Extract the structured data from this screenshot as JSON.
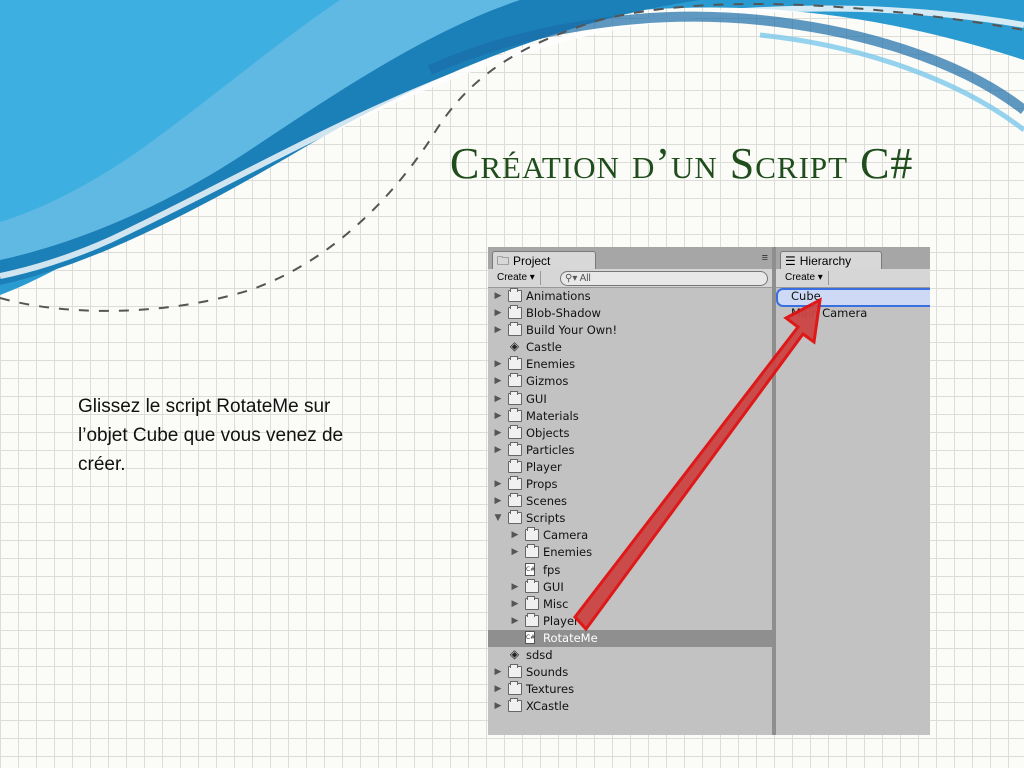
{
  "slide": {
    "title": "Création d’un Script C#",
    "body_text": "Glissez le script RotateMe sur l’objet Cube que vous venez de créer."
  },
  "project_panel": {
    "tab_label": "Project",
    "create_label": "Create ▾",
    "search_placeholder": "All",
    "menu_icon": "≡",
    "items": [
      {
        "label": "Animations",
        "type": "folder",
        "depth": 0,
        "expandable": true
      },
      {
        "label": "Blob-Shadow",
        "type": "folder",
        "depth": 0,
        "expandable": true
      },
      {
        "label": "Build Your Own!",
        "type": "folder",
        "depth": 0,
        "expandable": true
      },
      {
        "label": "Castle",
        "type": "scene",
        "depth": 0,
        "expandable": false
      },
      {
        "label": "Enemies",
        "type": "folder",
        "depth": 0,
        "expandable": true
      },
      {
        "label": "Gizmos",
        "type": "folder",
        "depth": 0,
        "expandable": true
      },
      {
        "label": "GUI",
        "type": "folder",
        "depth": 0,
        "expandable": true
      },
      {
        "label": "Materials",
        "type": "folder",
        "depth": 0,
        "expandable": true
      },
      {
        "label": "Objects",
        "type": "folder",
        "depth": 0,
        "expandable": true
      },
      {
        "label": "Particles",
        "type": "folder",
        "depth": 0,
        "expandable": true
      },
      {
        "label": "Player",
        "type": "folder",
        "depth": 0,
        "expandable": false
      },
      {
        "label": "Props",
        "type": "folder",
        "depth": 0,
        "expandable": true
      },
      {
        "label": "Scenes",
        "type": "folder",
        "depth": 0,
        "expandable": true
      },
      {
        "label": "Scripts",
        "type": "folder",
        "depth": 0,
        "expandable": true,
        "expanded": true
      },
      {
        "label": "Camera",
        "type": "folder",
        "depth": 1,
        "expandable": true
      },
      {
        "label": "Enemies",
        "type": "folder",
        "depth": 1,
        "expandable": true
      },
      {
        "label": "fps",
        "type": "script",
        "depth": 1,
        "expandable": false
      },
      {
        "label": "GUI",
        "type": "folder",
        "depth": 1,
        "expandable": true
      },
      {
        "label": "Misc",
        "type": "folder",
        "depth": 1,
        "expandable": true
      },
      {
        "label": "Player",
        "type": "folder",
        "depth": 1,
        "expandable": true
      },
      {
        "label": "RotateMe",
        "type": "script",
        "depth": 1,
        "expandable": false,
        "selected": true
      },
      {
        "label": "sdsd",
        "type": "scene",
        "depth": 0,
        "expandable": false
      },
      {
        "label": "Sounds",
        "type": "folder",
        "depth": 0,
        "expandable": true
      },
      {
        "label": "Textures",
        "type": "folder",
        "depth": 0,
        "expandable": true
      },
      {
        "label": "XCastle",
        "type": "folder",
        "depth": 0,
        "expandable": true
      }
    ]
  },
  "hierarchy_panel": {
    "tab_label": "Hierarchy",
    "create_label": "Create ▾",
    "items": [
      {
        "label": "Cube",
        "selected": true
      },
      {
        "label": "Main Camera",
        "selected": false
      }
    ]
  },
  "colors": {
    "title": "#1f4d1c",
    "drag_arrow": "#e02020",
    "hierarchy_highlight": "#3a6fe0"
  }
}
